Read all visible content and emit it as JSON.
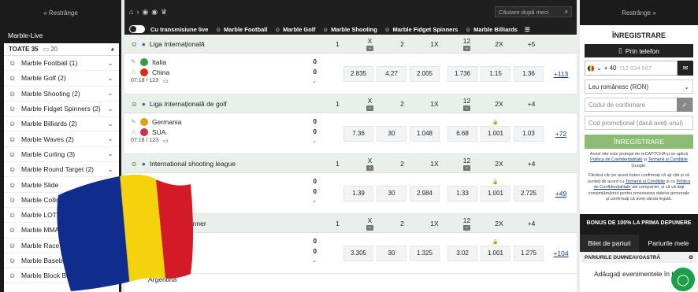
{
  "left": {
    "collapse_label": "« Restrânge",
    "section_title": "Marble-Live",
    "all_label": "TOATE 35",
    "all_count": "20",
    "items": [
      {
        "label": "Marble Football",
        "count": "(1)"
      },
      {
        "label": "Marble Golf",
        "count": "(2)"
      },
      {
        "label": "Marble Shooting",
        "count": "(2)"
      },
      {
        "label": "Marble Fidget Spinners",
        "count": "(2)"
      },
      {
        "label": "Marble Billiards",
        "count": "(2)"
      },
      {
        "label": "Marble Waves",
        "count": "(2)"
      },
      {
        "label": "Marble Curling",
        "count": "(3)"
      },
      {
        "label": "Marble Round Target",
        "count": "(2)"
      },
      {
        "label": "Marble Slide",
        "count": ""
      },
      {
        "label": "Marble Collision",
        "count": ""
      },
      {
        "label": "Marble LOTTO",
        "count": "(2)"
      },
      {
        "label": "Marble MMA",
        "count": "(2)"
      },
      {
        "label": "Marble Race",
        "count": "(2)"
      },
      {
        "label": "Marble Baseball",
        "count": "(2)"
      },
      {
        "label": "Marble Block Breaker",
        "count": "(2)"
      }
    ]
  },
  "topnav": {
    "search_placeholder": "Căutare după meci"
  },
  "filters": {
    "live_label": "Cu transmisiune live",
    "items": [
      "Marble Football",
      "Marble Golf",
      "Marble Shooting",
      "Marble Fidget Spinners",
      "Marble Billiards"
    ]
  },
  "leagues": [
    {
      "name": "Liga Internațională",
      "headers": [
        "1",
        "X",
        "2",
        "1X",
        "12",
        "2X",
        "+5"
      ],
      "team1": "Italia",
      "team2": "China",
      "score1": "0",
      "score2": "0",
      "meta": "07:18 / 123",
      "odds": [
        "2.835",
        "4.27",
        "2.005",
        "1.736",
        "1.15",
        "1.36"
      ],
      "more": "+113",
      "flag1": "#3a9b45",
      "flag2": "#de2910"
    },
    {
      "name": "Liga Internațională de golf",
      "headers": [
        "1",
        "X",
        "2",
        "1X",
        "12",
        "2X",
        "+4"
      ],
      "team1": "Germania",
      "team2": "SUA",
      "score1": "0",
      "score2": "0",
      "meta": "07:18 / 123",
      "odds": [
        "7.36",
        "30",
        "1.048",
        "6.68",
        "1.001",
        "1.03"
      ],
      "more": "+72",
      "flag1": "#e0a020",
      "flag2": "#c8334a"
    },
    {
      "name": "International shooting league",
      "headers": [
        "1",
        "X",
        "2",
        "1X",
        "12",
        "2X",
        "+4"
      ],
      "team1": "",
      "team2": "",
      "score1": "0",
      "score2": "0",
      "meta": "",
      "odds": [
        "1.39",
        "30",
        "2.984",
        "1.33",
        "1.001",
        "2.725"
      ],
      "more": "+49",
      "flag1": "#ccc",
      "flag2": "#ccc"
    },
    {
      "name": "ațională de spinner",
      "headers": [
        "1",
        "X",
        "2",
        "1X",
        "12",
        "2X",
        "+4"
      ],
      "team1": "",
      "team2": "",
      "score1": "0",
      "score2": "0",
      "meta": "04:20 / 140",
      "odds": [
        "3.305",
        "30",
        "1.325",
        "3.02",
        "1.001",
        "1.275"
      ],
      "more": "+104",
      "flag1": "#ccc",
      "flag2": "#d93b3b"
    }
  ],
  "partial_team": "Argentina",
  "right": {
    "collapse_label": "Restrânge »",
    "title": "ÎNREGISTRARE",
    "phone_button": "Prin telefon",
    "phone_prefix": "+ 40",
    "phone_placeholder": "712 034 567",
    "currency": "Leu românesc (RON)",
    "confirm_placeholder": "Codul de confirmare",
    "promo_placeholder": "Cod promoțional (dacă aveți unul)",
    "register_button": "ÎNREGISTRARE",
    "recaptcha_1": "Acest site este protejat de reCAPTCHA și se aplică",
    "recaptcha_2": "Politica de Confidențialitate",
    "recaptcha_3": "și",
    "recaptcha_4": "Termenii și Condițiile",
    "recaptcha_5": "Google.",
    "consent_1": "Făcând clic pe acest buton confirmați că ați citit și că sunteți de acord cu",
    "consent_2": "Termenii și Condițiile",
    "consent_3": "și cu",
    "consent_4": "Politica de Confidențialitate",
    "consent_5": "ale companiei, și că vă dați consimțământul pentru procesarea datelor personale și confirmați că aveți vârsta legală.",
    "bonus": "BONUS DE 100% LA PRIMA DEPUNERE",
    "tab_betslip": "Bilet de pariuri",
    "tab_mybets": "Pariurile mele",
    "betslip_header": "PARIURILE DUMNEAVOASTRĂ",
    "betslip_message": "Adăugați evenimentele în bilet"
  }
}
